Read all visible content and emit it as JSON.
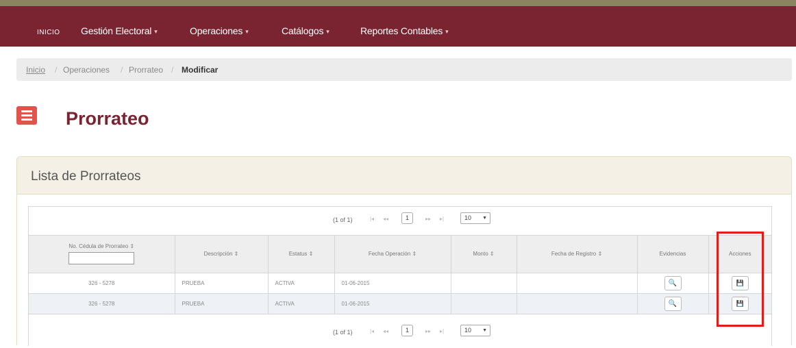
{
  "navbar": {
    "items": [
      {
        "label": "INICIO",
        "dropdown": false
      },
      {
        "label": "Gestión Electoral",
        "dropdown": true
      },
      {
        "label": "Operaciones",
        "dropdown": true
      },
      {
        "label": "Catálogos",
        "dropdown": true
      },
      {
        "label": "Reportes Contables",
        "dropdown": true
      }
    ],
    "background": "#7a2431",
    "caret": "▾"
  },
  "breadcrumb": {
    "items": [
      "Inicio",
      "Operaciones",
      "Prorrateo",
      "Modificar"
    ],
    "separator": "/"
  },
  "page": {
    "title": "Prorrateo",
    "icon": "menu-icon",
    "accent": "#e2544b"
  },
  "panel": {
    "title": "Lista de Prorrateos"
  },
  "paginator": {
    "count_text": "(1 of 1)",
    "first": "|◂",
    "prev": "◂◂",
    "current_page": "1",
    "next": "▸▸",
    "last": "▸|",
    "rows_per_page": "10",
    "select_arrow": "▼"
  },
  "table": {
    "sort_glyph": "⇕",
    "columns": [
      "No. Cédula de Prorrateo",
      "Descripción",
      "Estatus",
      "Fecha Operación",
      "Monto",
      "Fecha de Registro",
      "Evidencias",
      "Acciones"
    ],
    "rows": [
      {
        "cedula": "326 - 5278",
        "descripcion": "PRUEBA",
        "estatus": "ACTIVA",
        "fecha_operacion": "01-06-2015",
        "monto": "",
        "fecha_registro": "",
        "evidencias_icon": "search-icon",
        "acciones_icon": "save-icon"
      },
      {
        "cedula": "326 - 5278",
        "descripcion": "PRUEBA",
        "estatus": "ACTIVA",
        "fecha_operacion": "01-06-2015",
        "monto": "",
        "fecha_registro": "",
        "evidencias_icon": "search-icon",
        "acciones_icon": "save-icon"
      }
    ],
    "search_glyph": "🔍",
    "save_glyph": "💾"
  },
  "annotation": {
    "highlight_color": "#e41b17"
  }
}
